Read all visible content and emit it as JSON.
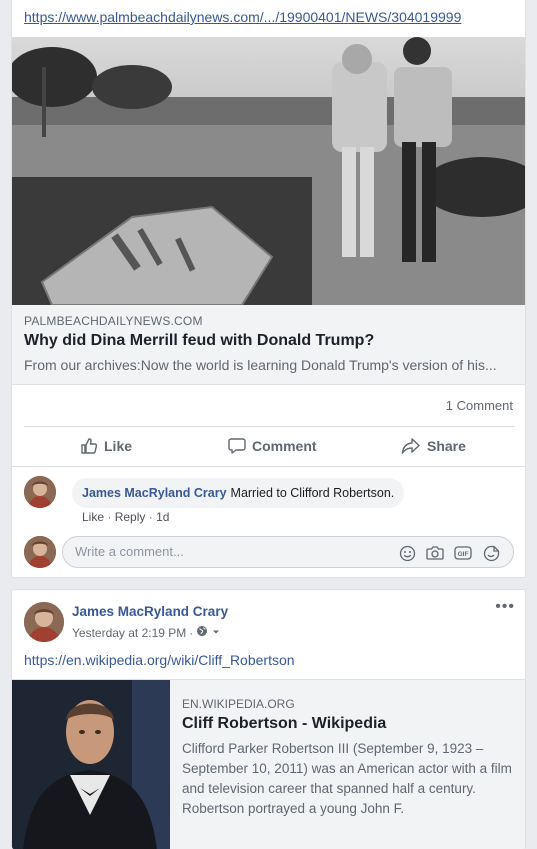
{
  "post1": {
    "link_text": "https://www.palmbeachdailynews.com/.../19900401/NEWS/304019999",
    "image_alt": "Archive photo of Dina Merrill and Donald Trump",
    "preview": {
      "domain": "PALMBEACHDAILYNEWS.COM",
      "title": "Why did Dina Merrill feud with Donald Trump?",
      "description": "From our archives:Now the world is learning Donald Trump's version of his..."
    },
    "comment_count": "1 Comment",
    "actions": {
      "like": "Like",
      "comment": "Comment",
      "share": "Share"
    },
    "comment": {
      "author": "James MacRyland Crary",
      "text": "Married to Clifford Robertson.",
      "like": "Like",
      "reply": "Reply",
      "separator": "·",
      "time": "1d"
    },
    "composer_placeholder": "Write a comment..."
  },
  "post2": {
    "author": "James MacRyland Crary",
    "time": "Yesterday at 2:19 PM",
    "dot": "·",
    "link_text": "https://en.wikipedia.org/wiki/Cliff_Robertson",
    "preview": {
      "domain": "EN.WIKIPEDIA.ORG",
      "title": "Cliff Robertson - Wikipedia",
      "description": "Clifford Parker Robertson III (September 9, 1923 – September 10, 2011) was an American actor with a film and television career that spanned half a century. Robertson portrayed a young John F."
    },
    "more": "•••"
  },
  "colors": {
    "link": "#365899",
    "author": "#385898",
    "secondary": "#606770",
    "background": "#e9ebee"
  },
  "icons": [
    "thumbs-up-icon",
    "comment-icon",
    "share-icon",
    "smiley-icon",
    "camera-icon",
    "gif-icon",
    "sticker-icon",
    "globe-icon",
    "chevron-down-icon",
    "more-icon"
  ]
}
